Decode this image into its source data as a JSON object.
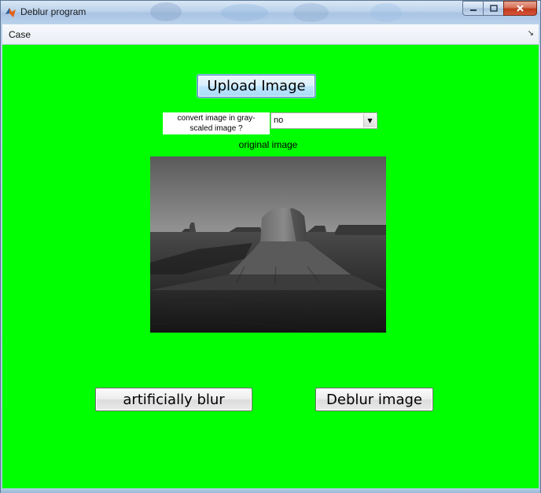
{
  "window": {
    "title": "Deblur program",
    "app_icon": "matlab-icon",
    "controls": [
      "minimize-icon",
      "maximize-icon",
      "close-icon"
    ]
  },
  "menubar": {
    "items": [
      {
        "label": "Case"
      }
    ],
    "right_icon": "dock-arrow-icon"
  },
  "main": {
    "background": "#00ff00",
    "upload_button": "Upload Image",
    "convert_label": "convert image in gray-scaled image ?",
    "convert_select": {
      "value": "no"
    },
    "image_caption": "original image",
    "image_description": "grayscale desert landscape photo",
    "blur_button": "artificially blur",
    "deblur_button": "Deblur image"
  }
}
